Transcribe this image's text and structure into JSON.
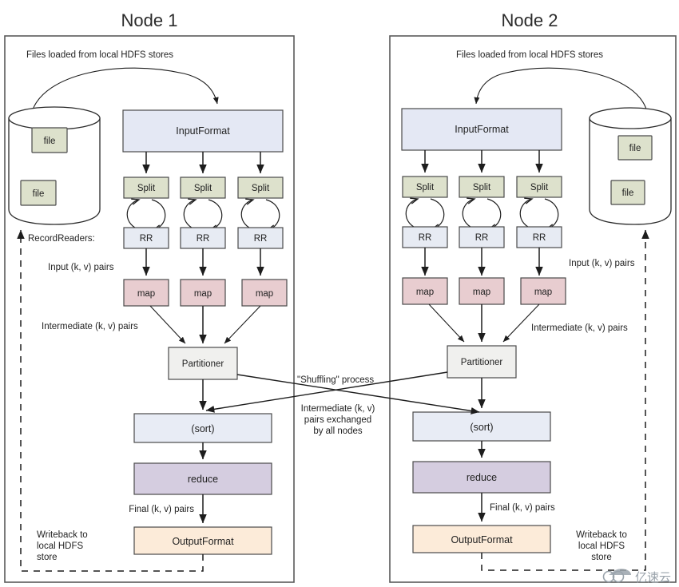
{
  "diagram": {
    "title_node1": "Node 1",
    "title_node2": "Node 2",
    "watermark": "亿速云"
  },
  "colors": {
    "input_format": "#e4e8f4",
    "split": "#dde1cc",
    "record_reader": "#e7ebf3",
    "map": "#e8cdd0",
    "partitioner": "#f0f0ee",
    "sort": "#e8ecf5",
    "reduce": "#d5cde0",
    "output_format": "#fcebd9",
    "file": "#dde1cc",
    "frame_stroke": "#5a5a5a",
    "arrow": "#1d1d1d"
  },
  "node1": {
    "title": "Node 1",
    "header_note": "Files loaded from local HDFS stores",
    "files": [
      "file",
      "file"
    ],
    "input_format": "InputFormat",
    "splits": [
      "Split",
      "Split",
      "Split"
    ],
    "record_readers": [
      "RR",
      "RR",
      "RR"
    ],
    "record_readers_label": "RecordReaders:",
    "input_pairs_label": "Input (k, v) pairs",
    "maps": [
      "map",
      "map",
      "map"
    ],
    "intermediate_pairs_label": "Intermediate (k, v) pairs",
    "partitioner": "Partitioner",
    "sort": "(sort)",
    "reduce": "reduce",
    "final_pairs_label": "Final (k, v) pairs",
    "output_format": "OutputFormat",
    "writeback_label_lines": [
      "Writeback to",
      "local HDFS",
      "store"
    ]
  },
  "node2": {
    "title": "Node 2",
    "header_note": "Files loaded from local HDFS stores",
    "files": [
      "file",
      "file"
    ],
    "input_format": "InputFormat",
    "splits": [
      "Split",
      "Split",
      "Split"
    ],
    "record_readers": [
      "RR",
      "RR",
      "RR"
    ],
    "input_pairs_label": "Input (k, v) pairs",
    "maps": [
      "map",
      "map",
      "map"
    ],
    "intermediate_pairs_label": "Intermediate (k, v) pairs",
    "partitioner": "Partitioner",
    "sort": "(sort)",
    "reduce": "reduce",
    "final_pairs_label": "Final (k, v) pairs",
    "output_format": "OutputFormat",
    "writeback_label_lines": [
      "Writeback to",
      "local HDFS",
      "store"
    ]
  },
  "shuffle": {
    "process_label": "\"Shuffling\" process",
    "exchange_label_lines": [
      "Intermediate (k, v)",
      "pairs exchanged",
      "by all nodes"
    ]
  }
}
